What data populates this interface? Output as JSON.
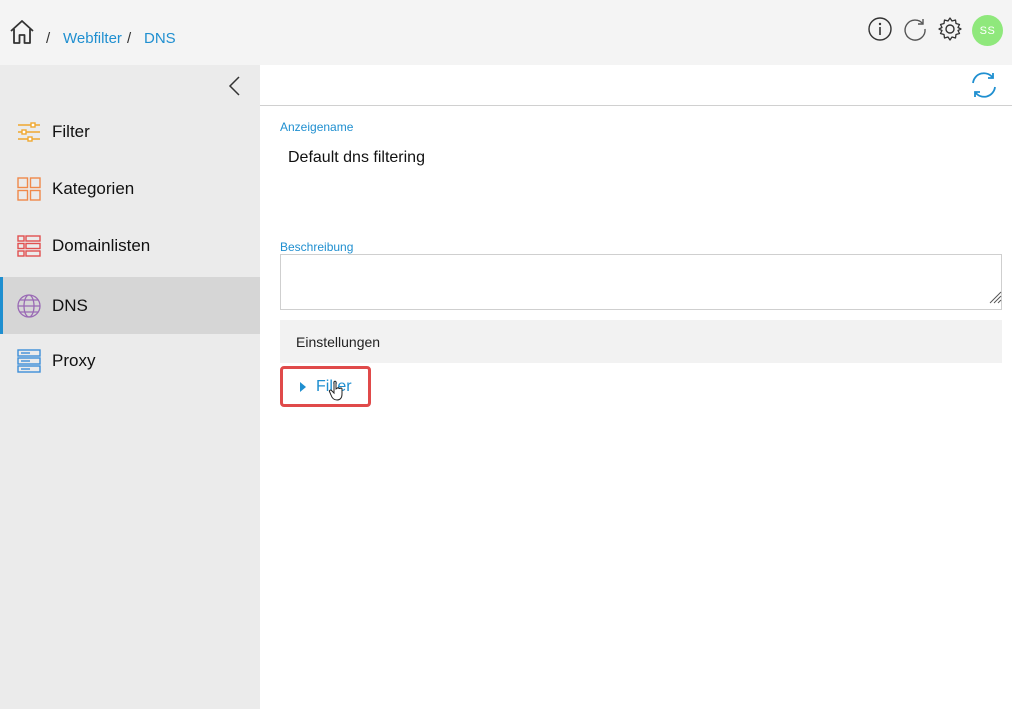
{
  "breadcrumb": {
    "separator": "/",
    "items": [
      {
        "label": "Webfilter"
      },
      {
        "label": "DNS"
      }
    ]
  },
  "header": {
    "icons": [
      "info-icon",
      "refresh-icon",
      "settings-icon"
    ],
    "avatar_initials": "SS",
    "avatar_color": "#8fe87c"
  },
  "sidebar": {
    "items": [
      {
        "label": "Filter",
        "icon": "sliders-icon",
        "color": "#f0a830"
      },
      {
        "label": "Kategorien",
        "icon": "grid-icon",
        "color": "#f0894a"
      },
      {
        "label": "Domainlisten",
        "icon": "list-icon",
        "color": "#e05050"
      },
      {
        "label": "DNS",
        "icon": "globe-icon",
        "color": "#9a6ab5",
        "active": true
      },
      {
        "label": "Proxy",
        "icon": "server-icon",
        "color": "#3d8fd8"
      }
    ]
  },
  "form": {
    "display_name_label": "Anzeigename",
    "display_name_value": "Default dns filtering",
    "description_label": "Beschreibung",
    "description_value": "",
    "section_title": "Einstellungen",
    "filter_toggle_label": "Filter"
  },
  "colors": {
    "accent": "#1f8fd0",
    "highlight_border": "#e04a4a"
  }
}
